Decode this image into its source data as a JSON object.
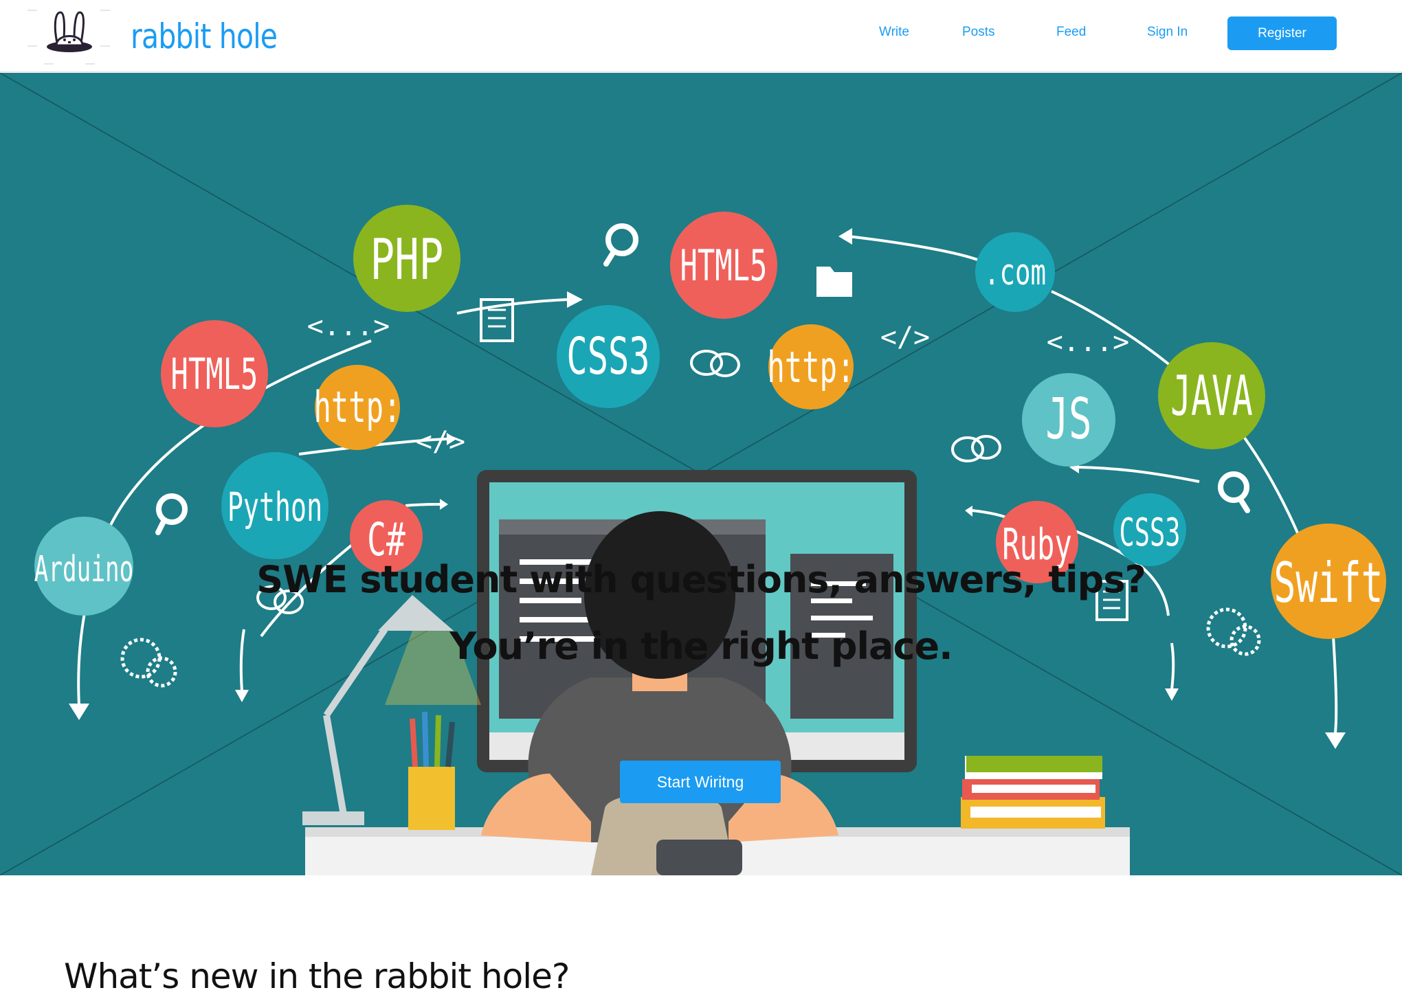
{
  "header": {
    "brand_name": "rabbit hole",
    "logo_icon": "rabbit-in-hat-icon",
    "nav": [
      {
        "label": "Write"
      },
      {
        "label": "Posts"
      },
      {
        "label": "Feed"
      },
      {
        "label": "Sign In"
      }
    ],
    "register_label": "Register"
  },
  "hero": {
    "headline": "SWE student with questions, answers, tips?",
    "subheadline": "You’re in the right place.",
    "cta_label": "Start Wiritng",
    "image_bubbles": [
      "PHP",
      "HTML5",
      ".com",
      "HTML5",
      "http:",
      "CSS3",
      "http:",
      "JS",
      "JAVA",
      "Python",
      "C#",
      "Ruby",
      "CSS3",
      "Arduino",
      "Swift"
    ],
    "image_tags": [
      "<...>",
      "</>",
      "</>",
      "<...>",
      "</>"
    ]
  },
  "section": {
    "title": "What’s new in the rabbit hole?"
  },
  "colors": {
    "brand_blue": "#1b9cf2",
    "hero_bg": "#1e7d87"
  }
}
